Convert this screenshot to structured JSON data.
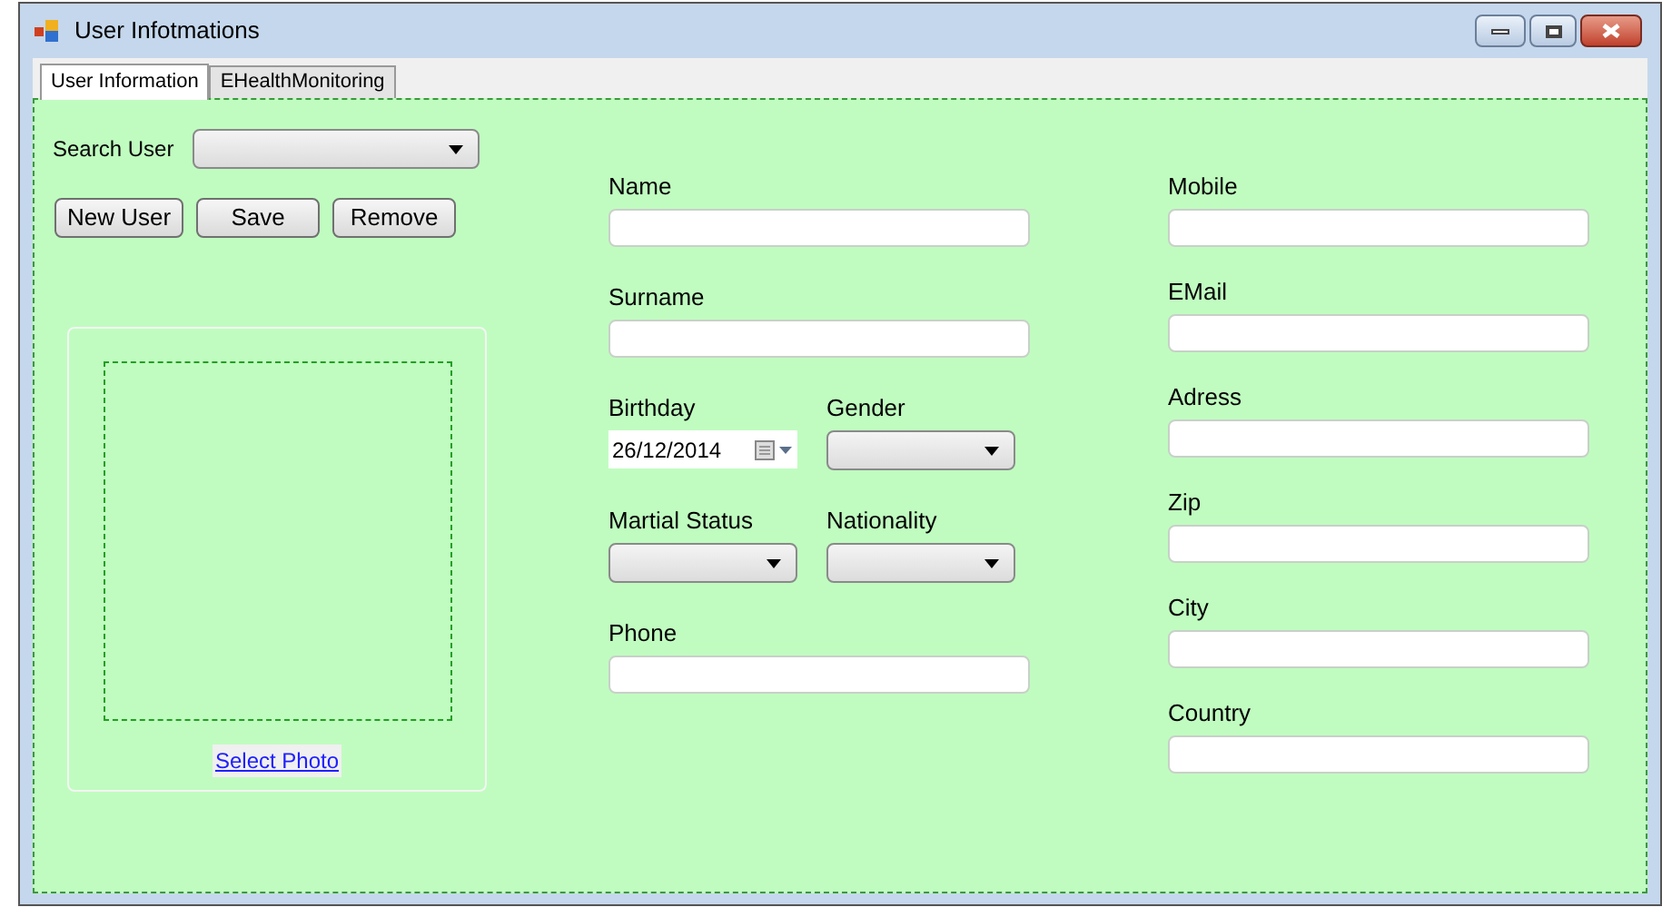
{
  "window": {
    "title": "User Infotmations"
  },
  "tabs": [
    {
      "label": "User Information",
      "selected": true
    },
    {
      "label": "EHealthMonitoring",
      "selected": false
    }
  ],
  "search_user": {
    "label": "Search User"
  },
  "buttons": [
    "New User",
    "Save",
    "Remove"
  ],
  "photo": {
    "link": "Select Photo"
  },
  "middle_rows": [
    [
      {
        "label": "Name",
        "kind": "text"
      }
    ],
    [
      {
        "label": "Surname",
        "kind": "text"
      }
    ],
    [
      {
        "label": "Birthday",
        "kind": "date",
        "value": "26/12/2014"
      },
      {
        "label": "Gender",
        "kind": "dropdown"
      }
    ],
    [
      {
        "label": "Martial Status",
        "kind": "dropdown"
      },
      {
        "label": "Nationality",
        "kind": "dropdown"
      }
    ],
    [
      {
        "label": "Phone",
        "kind": "text"
      }
    ]
  ],
  "right_fields": [
    {
      "label": "Mobile",
      "kind": "text"
    },
    {
      "label": "EMail",
      "kind": "text"
    },
    {
      "label": "Adress",
      "kind": "text"
    },
    {
      "label": "Zip",
      "kind": "text"
    },
    {
      "label": "City",
      "kind": "text"
    },
    {
      "label": "Country",
      "kind": "text"
    }
  ]
}
